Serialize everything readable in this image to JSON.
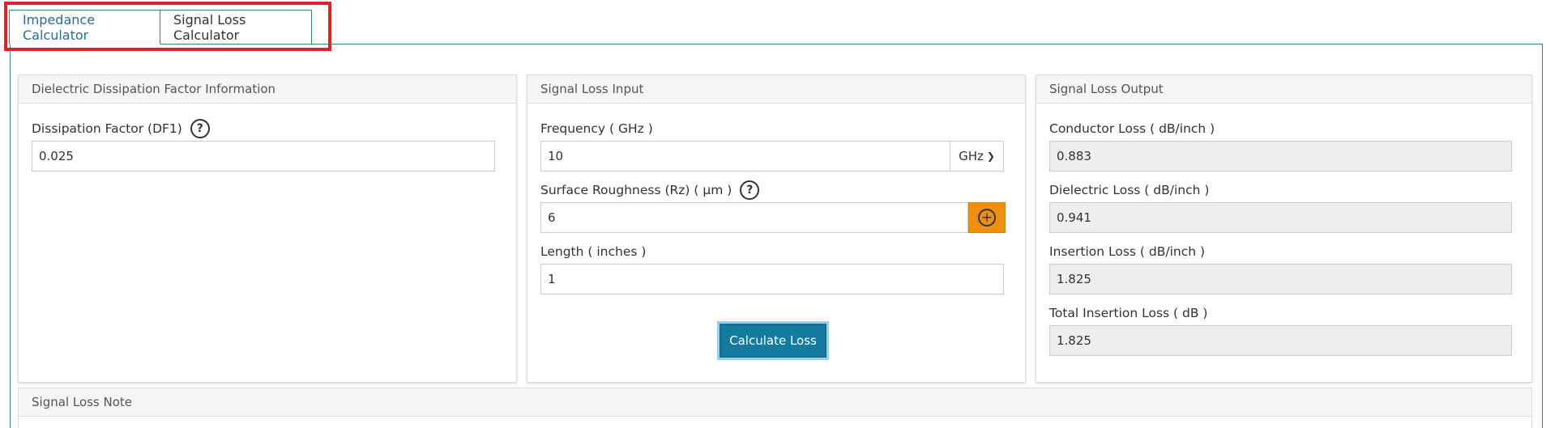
{
  "tabs": [
    {
      "label": "Impedance Calculator",
      "active": true
    },
    {
      "label": "Signal Loss Calculator",
      "active": false
    }
  ],
  "panels": {
    "dielectric": {
      "header": "Dielectric Dissipation Factor Information",
      "df_label": "Dissipation Factor (DF1)",
      "df_value": "0.025"
    },
    "input": {
      "header": "Signal Loss Input",
      "frequency_label": "Frequency ( GHz )",
      "frequency_value": "10",
      "frequency_unit": "GHz",
      "roughness_label": "Surface Roughness (Rz) ( µm )",
      "roughness_value": "6",
      "length_label": "Length ( inches )",
      "length_value": "1",
      "calculate_label": "Calculate Loss"
    },
    "output": {
      "header": "Signal Loss Output",
      "conductor_label": "Conductor Loss ( dB/inch )",
      "conductor_value": "0.883",
      "dielectric_label": "Dielectric Loss ( dB/inch )",
      "dielectric_value": "0.941",
      "insertion_label": "Insertion Loss ( dB/inch )",
      "insertion_value": "1.825",
      "total_label": "Total Insertion Loss ( dB )",
      "total_value": "1.825"
    },
    "note": {
      "header": "Signal Loss Note"
    }
  },
  "icons": {
    "help": "question-circle",
    "add": "plus-circle",
    "dropdown": "chevron-down"
  },
  "colors": {
    "accent_green": "#2e8a6e",
    "tab_active_text": "#2a6f8a",
    "highlight_red": "#e0202a",
    "add_button_orange": "#ee8f0f",
    "primary_button": "#137ba0"
  }
}
